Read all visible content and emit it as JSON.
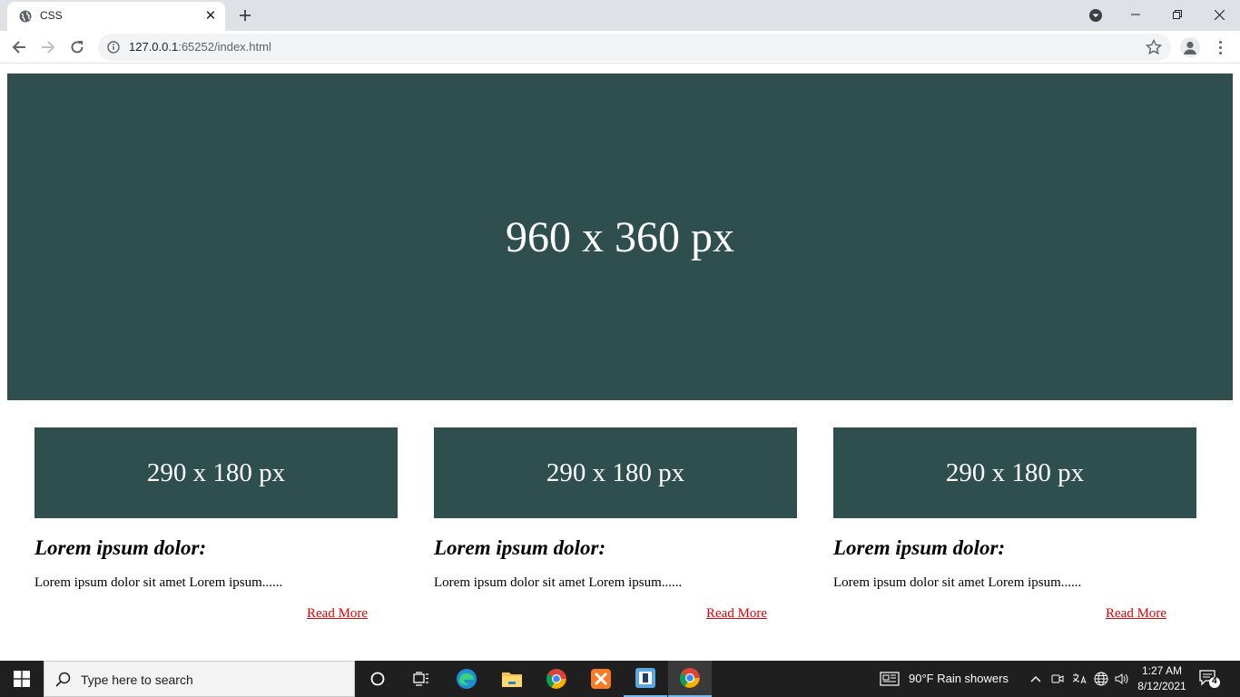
{
  "browser": {
    "tab_title": "CSS",
    "url_host": "127.0.0.1",
    "url_rest": ":65252/index.html"
  },
  "page": {
    "hero_text": "960 x 360 px",
    "cards": [
      {
        "image_text": "290 x 180 px",
        "heading": "Lorem ipsum dolor:",
        "body": "Lorem ipsum dolor sit amet Lorem ipsum......",
        "link": "Read More"
      },
      {
        "image_text": "290 x 180 px",
        "heading": "Lorem ipsum dolor:",
        "body": "Lorem ipsum dolor sit amet Lorem ipsum......",
        "link": "Read More"
      },
      {
        "image_text": "290 x 180 px",
        "heading": "Lorem ipsum dolor:",
        "body": "Lorem ipsum dolor sit amet Lorem ipsum......",
        "link": "Read More"
      }
    ]
  },
  "taskbar": {
    "search_placeholder": "Type here to search",
    "weather": "90°F  Rain showers",
    "time": "1:27 AM",
    "date": "8/12/2021",
    "notification_count": "4"
  },
  "colors": {
    "block_bg": "#2f4f4f",
    "link": "#e00000",
    "taskbar": "#1f1f1f"
  }
}
